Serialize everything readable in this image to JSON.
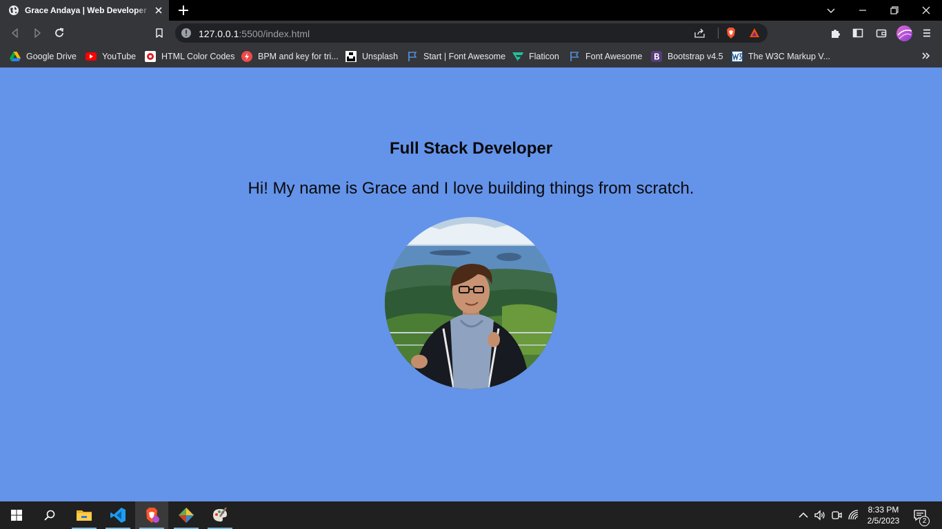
{
  "browser": {
    "tab_title": "Grace Andaya | Web Developer Portfolio",
    "url_host": "127.0.0.1",
    "url_rest": ":5500/index.html",
    "bookmarks": [
      {
        "label": "Google Drive",
        "icon": "google-drive-icon"
      },
      {
        "label": "YouTube",
        "icon": "youtube-icon"
      },
      {
        "label": "HTML Color Codes",
        "icon": "html-color-codes-icon"
      },
      {
        "label": "BPM and key for tri...",
        "icon": "bpm-icon"
      },
      {
        "label": "Unsplash",
        "icon": "unsplash-icon"
      },
      {
        "label": "Start | Font Awesome",
        "icon": "flag-icon"
      },
      {
        "label": "Flaticon",
        "icon": "flaticon-icon"
      },
      {
        "label": "Font Awesome",
        "icon": "flag-icon"
      },
      {
        "label": "Bootstrap v4.5",
        "icon": "bootstrap-icon"
      },
      {
        "label": "The W3C Markup V...",
        "icon": "w3c-icon"
      }
    ]
  },
  "page": {
    "role": "Full Stack Developer",
    "intro": "Hi! My name is Grace and I love building things from scratch.",
    "background_color": "#6493ea"
  },
  "taskbar": {
    "time": "8:33 PM",
    "date": "2/5/2023",
    "notification_count": "2",
    "apps": [
      "windows-start-icon",
      "search-icon",
      "file-explorer-icon",
      "vscode-icon",
      "brave-icon",
      "git-app-icon",
      "paint-icon"
    ]
  }
}
